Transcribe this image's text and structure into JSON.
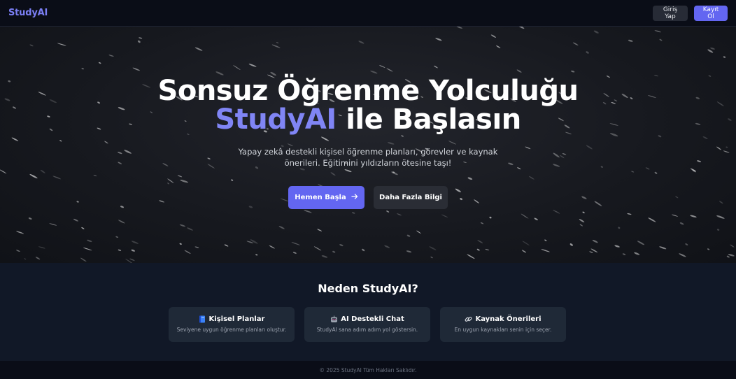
{
  "navbar": {
    "brand": "StudyAI",
    "login_label": "Giriş Yap",
    "signup_label": "Kayıt Ol"
  },
  "hero": {
    "title_line1": "Sonsuz Öğrenme Yolculuğu",
    "title_accent": "StudyAI",
    "title_rest": "ile Başlasın",
    "subtitle": "Yapay zekâ destekli kişisel öğrenme planları, görevler ve kaynak önerileri. Eğitimini yıldızların ötesine taşı!",
    "primary_button": "Hemen Başla",
    "secondary_button": "Daha Fazla Bilgi"
  },
  "features": {
    "title": "Neden StudyAI?",
    "cards": [
      {
        "icon": "book-icon",
        "title": "Kişisel Planlar",
        "description": "Seviyene uygun öğrenme planları oluştur."
      },
      {
        "icon": "robot-icon",
        "title": "AI Destekli Chat",
        "description": "StudyAI sana adım adım yol göstersin."
      },
      {
        "icon": "link-icon",
        "title": "Kaynak Önerileri",
        "description": "En uygun kaynakları senin için seçer."
      }
    ]
  },
  "footer": {
    "text": "© 2025 StudyAI Tüm Hakları Saklıdır."
  },
  "colors": {
    "accent": "#6366f1",
    "accent_text": "#8085f5",
    "background": "#111827"
  }
}
